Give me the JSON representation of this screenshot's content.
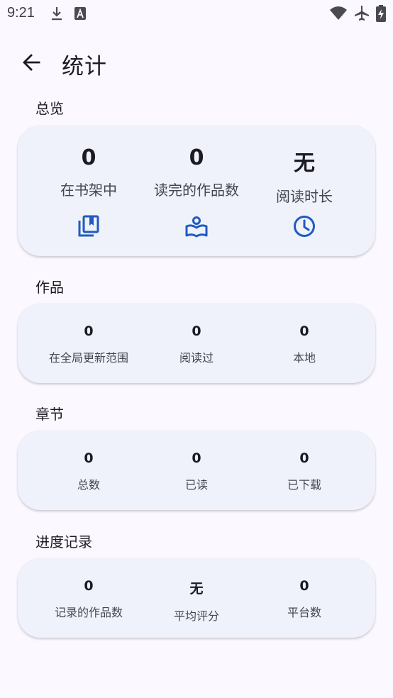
{
  "status_bar": {
    "time": "9:21",
    "left_icons": [
      "download-icon",
      "app-a-icon"
    ],
    "right_icons": [
      "wifi-icon",
      "airplane-mode-icon",
      "battery-charging-icon"
    ]
  },
  "header": {
    "back_icon": "arrow-back-icon",
    "title": "统计"
  },
  "sections": {
    "overview": {
      "label": "总览",
      "items": [
        {
          "value": "0",
          "label": "在书架中",
          "icon": "library-books-icon"
        },
        {
          "value": "0",
          "label": "读完的作品数",
          "icon": "reading-book-icon"
        },
        {
          "value": "无",
          "label": "阅读时长",
          "icon": "clock-icon"
        }
      ]
    },
    "works": {
      "label": "作品",
      "items": [
        {
          "value": "0",
          "label": "在全局更新范围"
        },
        {
          "value": "0",
          "label": "阅读过"
        },
        {
          "value": "0",
          "label": "本地"
        }
      ]
    },
    "chapters": {
      "label": "章节",
      "items": [
        {
          "value": "0",
          "label": "总数"
        },
        {
          "value": "0",
          "label": "已读"
        },
        {
          "value": "0",
          "label": "已下载"
        }
      ]
    },
    "tracking": {
      "label": "进度记录",
      "items": [
        {
          "value": "0",
          "label": "记录的作品数"
        },
        {
          "value": "无",
          "label": "平均评分"
        },
        {
          "value": "0",
          "label": "平台数"
        }
      ]
    }
  },
  "colors": {
    "background": "#fcf8ff",
    "card": "#eff1fb",
    "accent": "#1f5bc0",
    "text_primary": "#1b1b21",
    "text_secondary": "#44464f"
  }
}
